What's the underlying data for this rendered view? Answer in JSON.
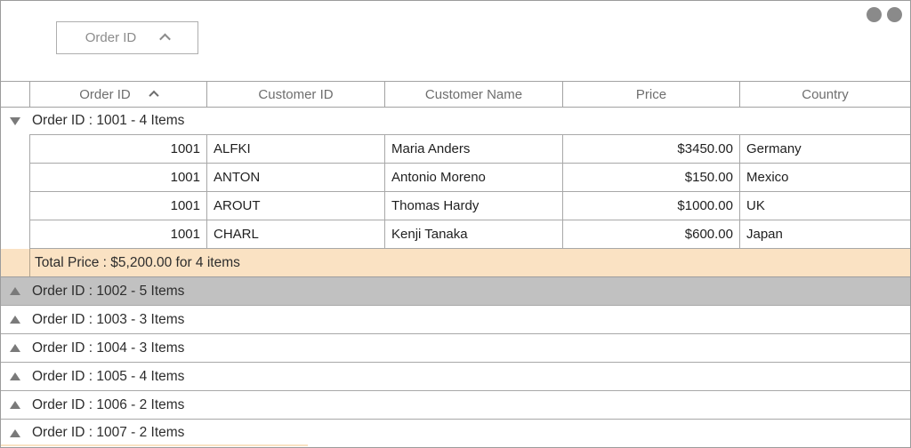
{
  "group_panel": {
    "chip_label": "Order ID"
  },
  "columns": {
    "order_id": "Order ID",
    "customer_id": "Customer ID",
    "customer_name": "Customer Name",
    "price": "Price",
    "country": "Country"
  },
  "groups": [
    {
      "label": "Order ID : 1001 - 4 Items",
      "state": "expanded",
      "summary": "Total Price : $5,200.00 for 4 items",
      "rows": [
        [
          "1001",
          "ALFKI",
          "Maria Anders",
          "$3450.00",
          "Germany"
        ],
        [
          "1001",
          "ANTON",
          "Antonio Moreno",
          "$150.00",
          "Mexico"
        ],
        [
          "1001",
          "AROUT",
          "Thomas Hardy",
          "$1000.00",
          "UK"
        ],
        [
          "1001",
          "CHARL",
          "Kenji Tanaka",
          "$600.00",
          "Japan"
        ]
      ]
    },
    {
      "label": "Order ID : 1002 - 5 Items",
      "state": "collapsed",
      "selected": true
    },
    {
      "label": "Order ID : 1003 - 3 Items",
      "state": "collapsed"
    },
    {
      "label": "Order ID : 1004 - 3 Items",
      "state": "collapsed"
    },
    {
      "label": "Order ID : 1005 - 4 Items",
      "state": "collapsed"
    },
    {
      "label": "Order ID : 1006 - 2 Items",
      "state": "collapsed"
    },
    {
      "label": "Order ID : 1007 - 2 Items",
      "state": "collapsed"
    }
  ],
  "colors": {
    "summary_bg": "#fae2c3",
    "selected_row_bg": "#c1c1c1",
    "header_text": "#6e6e6e",
    "grid_border": "#a8a8a8"
  }
}
